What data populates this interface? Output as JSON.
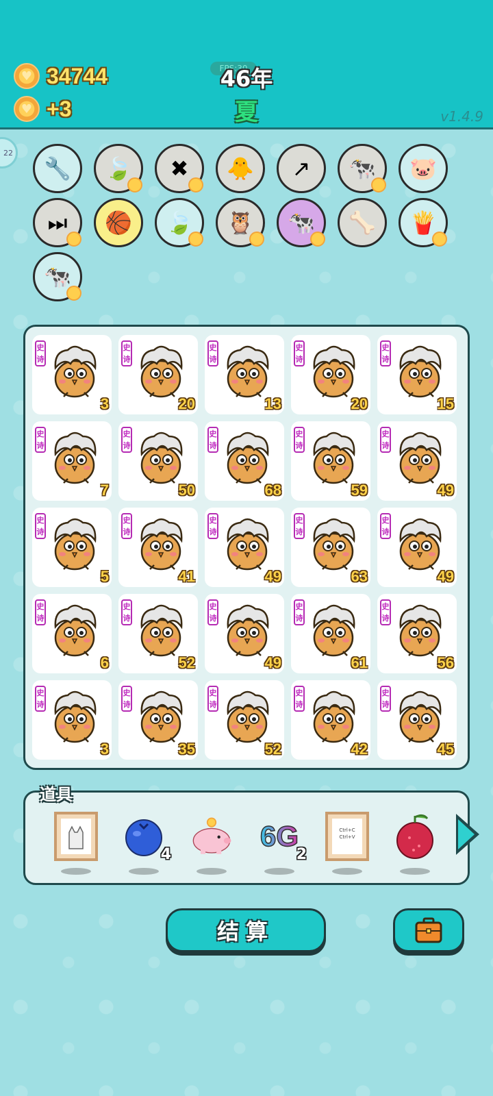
{
  "header": {
    "coins": "34744",
    "income": "+3",
    "fps_label": "FPS:30",
    "year": "46年",
    "season": "夏",
    "version": "v1.4.9",
    "side_badge": "22"
  },
  "relics": [
    {
      "icon": "air-pump-icon",
      "glyph": "🔧",
      "bg": "#cfeff0",
      "coin": false
    },
    {
      "icon": "leaf-icon",
      "glyph": "🍃",
      "bg": "#dcdcd6",
      "coin": true
    },
    {
      "icon": "remove-tag-icon",
      "glyph": "✖",
      "bg": "#dcdcd6",
      "coin": true
    },
    {
      "icon": "chick-egg-icon",
      "glyph": "🐥",
      "bg": "#dcdcd6",
      "coin": false
    },
    {
      "icon": "upgrade-arrow-icon",
      "glyph": "↗",
      "bg": "#dcdcd6",
      "coin": false
    },
    {
      "icon": "cow-pair-icon",
      "glyph": "🐄",
      "bg": "#dcdcd6",
      "coin": true
    },
    {
      "icon": "piggy-bank-icon",
      "glyph": "🐷",
      "bg": "#cfeff0",
      "coin": false
    },
    {
      "icon": "skip-icon",
      "glyph": "⏭",
      "bg": "#dcdcd6",
      "coin": true
    },
    {
      "icon": "basketballs-icon",
      "glyph": "🏀",
      "bg": "#f9ef8a",
      "coin": false
    },
    {
      "icon": "leaf-icon",
      "glyph": "🍃",
      "bg": "#cfeff0",
      "coin": true
    },
    {
      "icon": "owl-pair-icon",
      "glyph": "🦉",
      "bg": "#dcdcd6",
      "coin": true
    },
    {
      "icon": "cow-pair-icon",
      "glyph": "🐄",
      "bg": "#d6a8e8",
      "coin": true
    },
    {
      "icon": "pet-bowl-icon",
      "glyph": "🦴",
      "bg": "#dcdcd6",
      "coin": false
    },
    {
      "icon": "fries-icon",
      "glyph": "🍟",
      "bg": "#cfeff0",
      "coin": true
    },
    {
      "icon": "cow-pair-icon",
      "glyph": "🐄",
      "bg": "#cfeff0",
      "coin": true
    }
  ],
  "board": {
    "rarity_label": "史诗",
    "cells": [
      "3",
      "20",
      "13",
      "20",
      "15",
      "7",
      "50",
      "68",
      "59",
      "49",
      "5",
      "41",
      "49",
      "63",
      "49",
      "6",
      "52",
      "49",
      "61",
      "56",
      "3",
      "35",
      "52",
      "42",
      "45"
    ]
  },
  "items": {
    "label": "道具",
    "list": [
      {
        "icon": "cat-frame-icon",
        "count": ""
      },
      {
        "icon": "blueberry-icon",
        "count": "4"
      },
      {
        "icon": "piggy-bank-icon",
        "count": ""
      },
      {
        "icon": "6g-icon",
        "count": "2",
        "text": "6G"
      },
      {
        "icon": "copy-paste-frame-icon",
        "count": "",
        "text": "Ctrl+C Ctrl+V"
      },
      {
        "icon": "lychee-icon",
        "count": ""
      }
    ]
  },
  "buttons": {
    "settle": "结算"
  },
  "colors": {
    "teal": "#17c3c6",
    "border": "#1f4a4c",
    "epic": "#c02cc0",
    "number": "#ffd34a"
  }
}
